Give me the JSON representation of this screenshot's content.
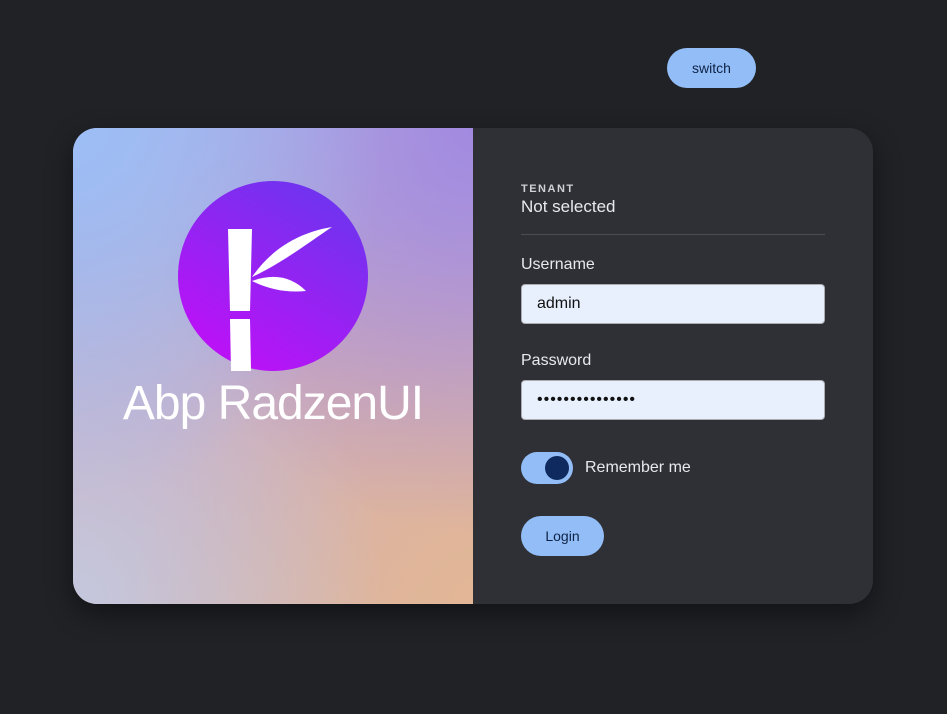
{
  "brand": {
    "name": "Abp RadzenUI",
    "logo_icon": "bamboo-k-logo",
    "logo_gradient": [
      "#6a36ee",
      "#c10ff7"
    ]
  },
  "tenant": {
    "caption": "TENANT",
    "value": "Not selected",
    "switch_label": "switch"
  },
  "form": {
    "username_label": "Username",
    "username_value": "admin",
    "password_label": "Password",
    "password_value": "•••••••••••••••",
    "remember_label": "Remember me",
    "remember_checked": true,
    "login_label": "Login"
  },
  "colors": {
    "accent": "#93bdf7",
    "accent_text": "#0d2346",
    "panel": "#2e3035",
    "background": "#202226"
  }
}
